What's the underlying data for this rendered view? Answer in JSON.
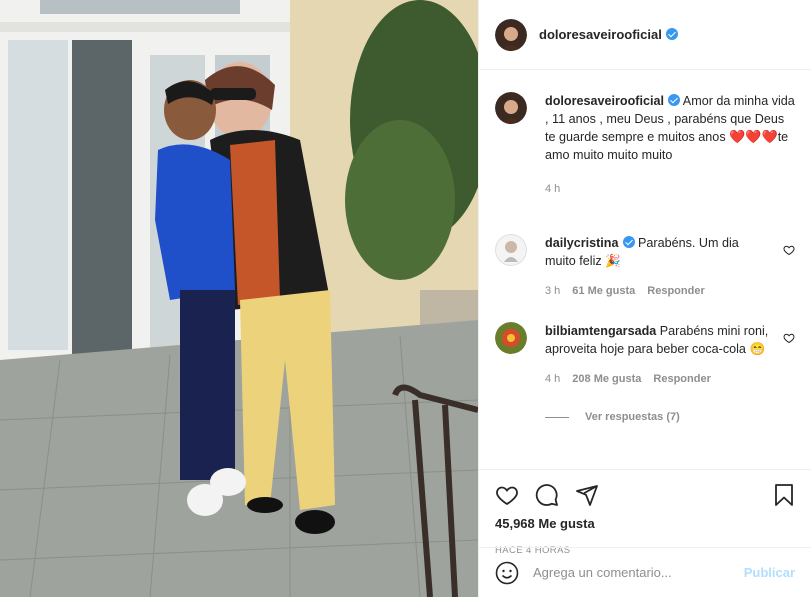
{
  "post": {
    "author": "doloresaveirooficial",
    "caption": {
      "username": "doloresaveirooficial",
      "text": "Amor da minha vida , 11 anos , meu Deus , parabéns que Deus te guarde sempre e muitos anos",
      "hearts": "❤️❤️❤️",
      "tail": "te amo muito muito muito",
      "time": "4 h"
    },
    "comments": [
      {
        "username": "dailycristina",
        "text": "Parabéns. Um dia muito feliz",
        "emoji": "🎉",
        "time": "3 h",
        "likes": "61 Me gusta",
        "reply": "Responder"
      },
      {
        "username": "bilbiamtengarsada",
        "text": "Parabéns mini roni, aproveita hoje para beber coca-cola",
        "emoji": "😁",
        "time": "4 h",
        "likes": "208 Me gusta",
        "reply": "Responder",
        "view_replies": "Ver respuestas (7)"
      }
    ],
    "likes_count": "45,968 Me gusta",
    "posted_ago": "HACE 4 HORAS"
  },
  "add_comment": {
    "placeholder": "Agrega un comentario...",
    "post_label": "Publicar"
  },
  "icons": [
    "heart-icon",
    "comment-icon",
    "share-icon",
    "bookmark-icon",
    "emoji-icon",
    "verified-badge-icon"
  ],
  "colors": {
    "verified": "#3897f0",
    "muted": "#8e8e8e",
    "publish": "#b2dffc"
  }
}
